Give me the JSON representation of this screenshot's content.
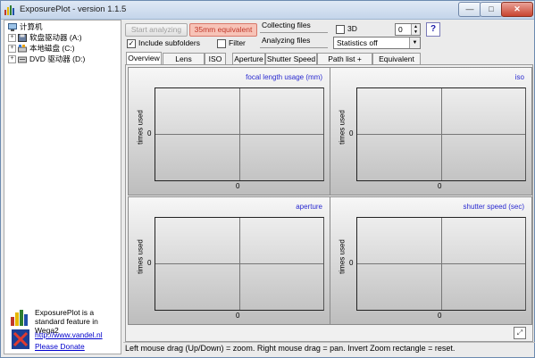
{
  "window": {
    "title": "ExposurePlot - version 1.1.5",
    "controls": {
      "minimize": "—",
      "maximize": "□",
      "close": "✕"
    }
  },
  "tree": {
    "root": "计算机",
    "items": [
      {
        "label": "软盘驱动器 (A:)",
        "icon": "floppy-drive-icon"
      },
      {
        "label": "本地磁盘 (C:)",
        "icon": "local-disk-icon"
      },
      {
        "label": "DVD 驱动器 (D:)",
        "icon": "dvd-drive-icon"
      }
    ],
    "expander": "+"
  },
  "promo": {
    "text": "ExposurePlot is a standard feature in Wega2",
    "url": "http://www.vandel.nl",
    "donate": "Please Donate"
  },
  "toolbar": {
    "start_label": "Start analyzing",
    "equiv_label": "35mm equivalent",
    "include_subfolders": "Include subfolders",
    "include_subfolders_checked": true,
    "filter": "Filter",
    "filter_checked": false,
    "collecting": "Collecting files",
    "analyzing": "Analyzing files",
    "three_d": "3D",
    "three_d_checked": false,
    "spinner_value": "0",
    "statistics": "Statistics off",
    "help": "?"
  },
  "tabs": [
    "Overview",
    "Lens Length",
    "ISO",
    "Aperture",
    "Shutter Speed",
    "Path list + Image",
    "Equivalent list"
  ],
  "selected_tab": "Overview",
  "chart_data": [
    {
      "type": "bar",
      "title": "focal length usage (mm)",
      "ylabel": "times used",
      "x_tick": "0",
      "y_tick": "0",
      "values": []
    },
    {
      "type": "bar",
      "title": "iso",
      "ylabel": "times used",
      "x_tick": "0",
      "y_tick": "0",
      "values": []
    },
    {
      "type": "bar",
      "title": "aperture",
      "ylabel": "times used",
      "x_tick": "0",
      "y_tick": "0",
      "values": []
    },
    {
      "type": "bar",
      "title": "shutter speed (sec)",
      "ylabel": "times used",
      "x_tick": "0",
      "y_tick": "0",
      "values": []
    }
  ],
  "status_bar": "Left mouse drag (Up/Down) = zoom. Right mouse drag = pan. Invert Zoom rectangle = reset."
}
